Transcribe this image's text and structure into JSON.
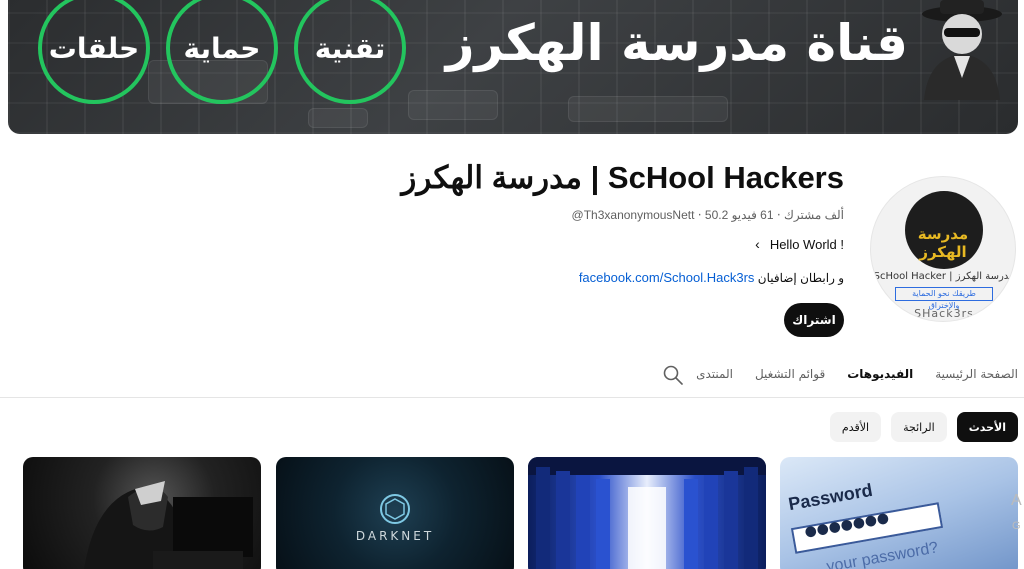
{
  "banner": {
    "title": "قناة مدرسة الهكرز",
    "rings": [
      "تقنية",
      "حماية",
      "حلقات"
    ],
    "accent": "#23c55e"
  },
  "avatar": {
    "emblem_text": "مدرسة الهكرز",
    "line1": "ScHool Hacker | مدرسة الهكرز",
    "line2": "طريقك نحو الحماية والإختراق",
    "line3": "SHack3rs"
  },
  "channel": {
    "name": "مدرسة الهكرز | ScHool Hackers",
    "meta": "@Th3xanonymousNett ‧ 50.2 ألف مشترك ‧ 61 فيديو",
    "description": "Hello World !",
    "link": "facebook.com/School.Hack3rs",
    "link_suffix": "و رابطان إضافيان",
    "subscribe_label": "اشتراك"
  },
  "tabs": [
    {
      "label": "الصفحة الرئيسية",
      "active": false
    },
    {
      "label": "الفيديوهات",
      "active": true
    },
    {
      "label": "قوائم التشغيل",
      "active": false
    },
    {
      "label": "المنتدى",
      "active": false
    }
  ],
  "filters": [
    {
      "label": "الأحدث",
      "active": true
    },
    {
      "label": "الرائجة",
      "active": false
    },
    {
      "label": "الأقدم",
      "active": false
    }
  ],
  "thumbnails": [
    {
      "icon": "hooded-hacker-image"
    },
    {
      "text": "DARKNET",
      "icon": "darknet-logo-icon"
    },
    {
      "icon": "server-room-image"
    },
    {
      "label": "Password",
      "dots": "●●●●●●●",
      "hint": "your password?",
      "icon": "password-field-image"
    }
  ],
  "peek": {
    "letter": "A",
    "small": "G"
  }
}
